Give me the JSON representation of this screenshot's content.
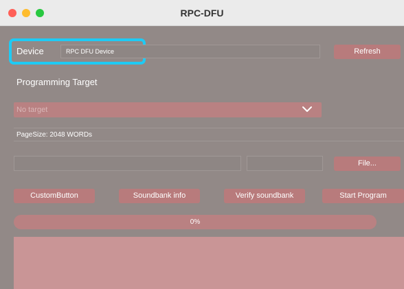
{
  "window": {
    "title": "RPC-DFU"
  },
  "device": {
    "label": "Device",
    "value": "RPC DFU Device",
    "refresh_label": "Refresh"
  },
  "programming_target": {
    "heading": "Programming Target",
    "selected": "No target"
  },
  "page_size": {
    "text": "PageSize: 2048 WORDs"
  },
  "file": {
    "path_value": "",
    "info_value": "",
    "button_label": "File..."
  },
  "actions": {
    "custom_label": "CustomButton",
    "soundbank_info_label": "Soundbank info",
    "verify_label": "Verify soundbank",
    "start_label": "Start Program"
  },
  "progress": {
    "value_percent": 0,
    "text": "0%"
  },
  "colors": {
    "highlight": "#1ecbf5",
    "button": "#b87b7c",
    "panel": "#928987"
  }
}
